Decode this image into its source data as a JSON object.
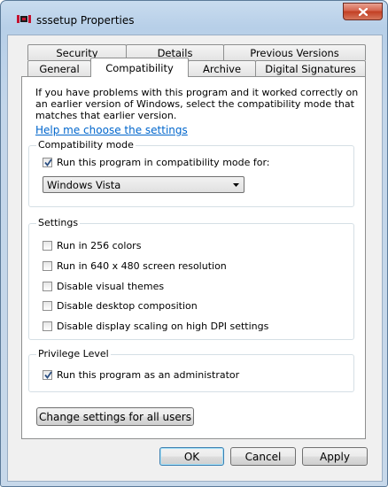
{
  "window": {
    "title": "sssetup Properties"
  },
  "tabs": {
    "row_back": [
      {
        "label": "Security"
      },
      {
        "label": "Details"
      },
      {
        "label": "Previous Versions"
      }
    ],
    "row_front": [
      {
        "label": "General"
      },
      {
        "label": "Compatibility",
        "active": true
      },
      {
        "label": "Archive"
      },
      {
        "label": "Digital Signatures"
      }
    ]
  },
  "intro": {
    "text": "If you have problems with this program and it worked correctly on an earlier version of Windows, select the compatibility mode that matches that earlier version.",
    "help_link": "Help me choose the settings"
  },
  "compat_mode": {
    "legend": "Compatibility mode",
    "checkbox_label": "Run this program in compatibility mode for:",
    "checked": true,
    "selected_os": "Windows Vista"
  },
  "settings": {
    "legend": "Settings",
    "items": [
      {
        "label": "Run in 256 colors",
        "checked": false
      },
      {
        "label": "Run in 640 x 480 screen resolution",
        "checked": false
      },
      {
        "label": "Disable visual themes",
        "checked": false
      },
      {
        "label": "Disable desktop composition",
        "checked": false
      },
      {
        "label": "Disable display scaling on high DPI settings",
        "checked": false
      }
    ]
  },
  "privilege": {
    "legend": "Privilege Level",
    "checkbox_label": "Run this program as an administrator",
    "checked": true
  },
  "buttons": {
    "change_all_users": "Change settings for all users",
    "ok": "OK",
    "cancel": "Cancel",
    "apply": "Apply"
  },
  "icons": {
    "app": "sssetup-app-icon",
    "close": "close-icon",
    "dropdown": "chevron-down-icon",
    "check": "checkmark-icon"
  },
  "colors": {
    "link": "#0066cc",
    "checkmark": "#2b4f82",
    "close_button": "#c23f23"
  }
}
